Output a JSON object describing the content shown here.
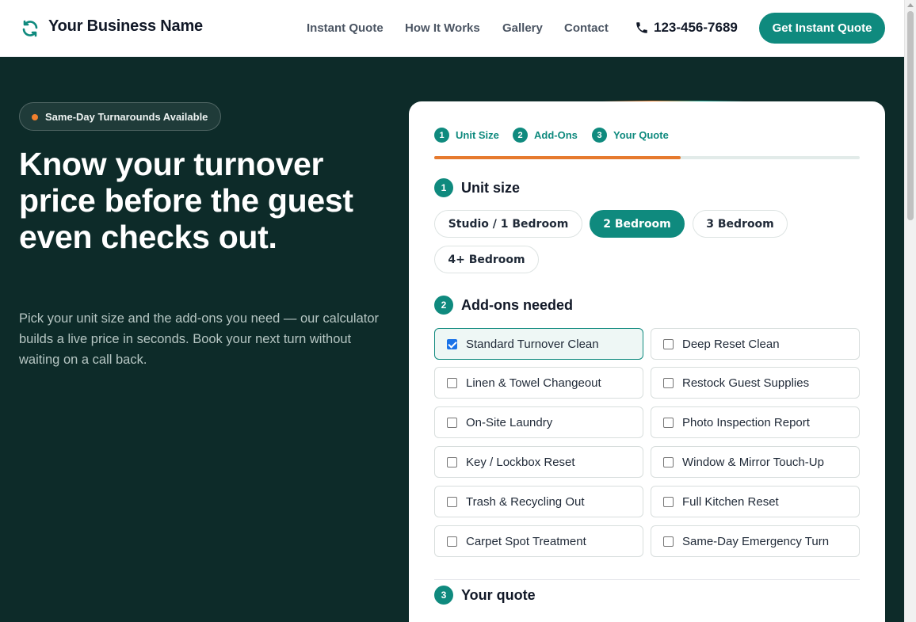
{
  "header": {
    "brand": "Your Business Name",
    "nav": [
      "Instant Quote",
      "How It Works",
      "Gallery",
      "Contact"
    ],
    "phone": "123-456-7689",
    "cta": "Get Instant Quote"
  },
  "hero": {
    "badge": "Same-Day Turnarounds Available",
    "title": "Know your turnover price before the guest even checks out.",
    "subtitle": "Pick your unit size and the add-ons you need — our calculator builds a live price in seconds. Book your next turn without waiting on a call back."
  },
  "steps": [
    {
      "num": "1",
      "label": "Unit Size"
    },
    {
      "num": "2",
      "label": "Add-Ons"
    },
    {
      "num": "3",
      "label": "Your Quote"
    }
  ],
  "progress_fraction": 0.58,
  "unit_section": {
    "num": "1",
    "title": "Unit size",
    "options": [
      "Studio / 1 Bedroom",
      "2 Bedroom",
      "3 Bedroom",
      "4+ Bedroom"
    ],
    "selected": "2 Bedroom"
  },
  "addons_section": {
    "num": "2",
    "title": "Add-ons needed",
    "options": [
      {
        "label": "Standard Turnover Clean",
        "checked": true
      },
      {
        "label": "Deep Reset Clean",
        "checked": false
      },
      {
        "label": "Linen & Towel Changeout",
        "checked": false
      },
      {
        "label": "Restock Guest Supplies",
        "checked": false
      },
      {
        "label": "On-Site Laundry",
        "checked": false
      },
      {
        "label": "Photo Inspection Report",
        "checked": false
      },
      {
        "label": "Key / Lockbox Reset",
        "checked": false
      },
      {
        "label": "Window & Mirror Touch-Up",
        "checked": false
      },
      {
        "label": "Trash & Recycling Out",
        "checked": false
      },
      {
        "label": "Full Kitchen Reset",
        "checked": false
      },
      {
        "label": "Carpet Spot Treatment",
        "checked": false
      },
      {
        "label": "Same-Day Emergency Turn",
        "checked": false
      }
    ]
  },
  "quote_section": {
    "num": "3",
    "title": "Your quote"
  },
  "colors": {
    "brand_teal": "#0f8a7e",
    "hero_bg": "#0d2b29",
    "accent_orange": "#e67a2e"
  }
}
